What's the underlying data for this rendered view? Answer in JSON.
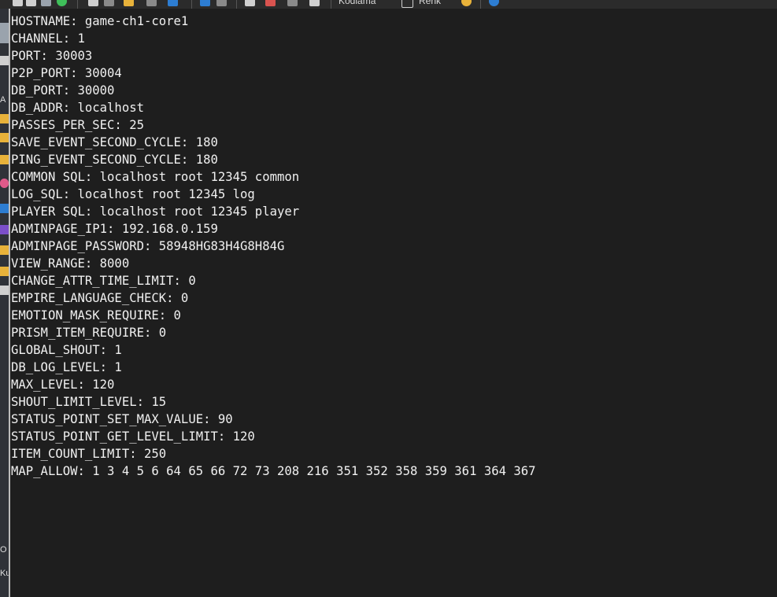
{
  "toolbar": {
    "tab1_label": "Kodlama",
    "tab2_label": "Renk",
    "colors": {
      "background": "#2b2b2b",
      "accent_blue": "#2d7dd2",
      "accent_yellow": "#e8b23a"
    }
  },
  "left_strip": {
    "labels": [
      "A",
      "O",
      "Ku"
    ]
  },
  "console": {
    "background": "#1e1e1e",
    "text_color": "#f0f0f0",
    "lines": [
      "HOSTNAME: game-ch1-core1",
      "CHANNEL: 1",
      "PORT: 30003",
      "P2P_PORT: 30004",
      "DB_PORT: 30000",
      "DB_ADDR: localhost",
      "PASSES_PER_SEC: 25",
      "SAVE_EVENT_SECOND_CYCLE: 180",
      "PING_EVENT_SECOND_CYCLE: 180",
      "COMMON SQL: localhost root 12345 common",
      "LOG_SQL: localhost root 12345 log",
      "PLAYER SQL: localhost root 12345 player",
      "ADMINPAGE_IP1: 192.168.0.159",
      "ADMINPAGE_PASSWORD: 58948HG83H4G8H84G",
      "VIEW_RANGE: 8000",
      "CHANGE_ATTR_TIME_LIMIT: 0",
      "EMPIRE_LANGUAGE_CHECK: 0",
      "EMOTION_MASK_REQUIRE: 0",
      "PRISM_ITEM_REQUIRE: 0",
      "GLOBAL_SHOUT: 1",
      "DB_LOG_LEVEL: 1",
      "MAX_LEVEL: 120",
      "SHOUT_LIMIT_LEVEL: 15",
      "STATUS_POINT_SET_MAX_VALUE: 90",
      "STATUS_POINT_GET_LEVEL_LIMIT: 120",
      "ITEM_COUNT_LIMIT: 250",
      "MAP_ALLOW: 1 3 4 5 6 64 65 66 72 73 208 216 351 352 358 359 361 364 367"
    ]
  }
}
